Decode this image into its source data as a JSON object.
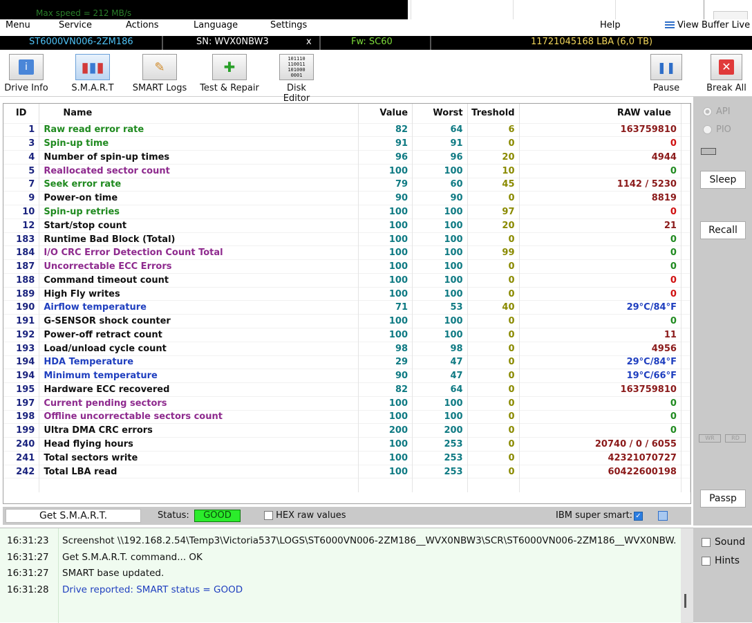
{
  "top_strip": {
    "speed_text": "Max speed = 212 MB/s"
  },
  "menu": {
    "items": [
      "Menu",
      "Service",
      "Actions",
      "Language",
      "Settings",
      "Help"
    ],
    "view_buffer": "View Buffer Live"
  },
  "drive": {
    "model": "ST6000VN006-2ZM186",
    "serial": "SN: WVX0NBW3",
    "close_glyph": "x",
    "firmware": "Fw: SC60",
    "capacity": "11721045168 LBA (6,0 TB)"
  },
  "toolbar": {
    "drive_info": "Drive Info",
    "smart": "S.M.A.R.T",
    "smart_logs": "SMART Logs",
    "test_repair": "Test & Repair",
    "disk_editor": "Disk Editor",
    "pause": "Pause",
    "break_all": "Break All"
  },
  "side": {
    "api": "API",
    "pio": "PIO",
    "sleep": "Sleep",
    "recall": "Recall",
    "wr": "WR",
    "rd": "RD",
    "passp": "Passp"
  },
  "table": {
    "headers": {
      "id": "ID",
      "name": "Name",
      "value": "Value",
      "worst": "Worst",
      "threshold": "Treshold",
      "raw": "RAW value"
    },
    "rows": [
      {
        "id": "1",
        "name": "Raw read error rate",
        "value": "82",
        "worst": "64",
        "threshold": "6",
        "raw": "163759810",
        "color": "#1f8a1f",
        "raw_color": "#8b1a1a"
      },
      {
        "id": "3",
        "name": "Spin-up time",
        "value": "91",
        "worst": "91",
        "threshold": "0",
        "raw": "0",
        "color": "#1f8a1f",
        "raw_color": "#d01010"
      },
      {
        "id": "4",
        "name": "Number of spin-up times",
        "value": "96",
        "worst": "96",
        "threshold": "20",
        "raw": "4944",
        "color": "#111111",
        "raw_color": "#8b1a1a"
      },
      {
        "id": "5",
        "name": "Reallocated sector count",
        "value": "100",
        "worst": "100",
        "threshold": "10",
        "raw": "0",
        "color": "#8e2a8e",
        "raw_color": "#1f8a1f"
      },
      {
        "id": "7",
        "name": "Seek error rate",
        "value": "79",
        "worst": "60",
        "threshold": "45",
        "raw": "1142 / 5230",
        "color": "#1f8a1f",
        "raw_color": "#8b1a1a"
      },
      {
        "id": "9",
        "name": "Power-on time",
        "value": "90",
        "worst": "90",
        "threshold": "0",
        "raw": "8819",
        "color": "#111111",
        "raw_color": "#8b1a1a"
      },
      {
        "id": "10",
        "name": "Spin-up retries",
        "value": "100",
        "worst": "100",
        "threshold": "97",
        "raw": "0",
        "color": "#1f8a1f",
        "raw_color": "#d01010"
      },
      {
        "id": "12",
        "name": "Start/stop count",
        "value": "100",
        "worst": "100",
        "threshold": "20",
        "raw": "21",
        "color": "#111111",
        "raw_color": "#8b1a1a"
      },
      {
        "id": "183",
        "name": "Runtime Bad Block (Total)",
        "value": "100",
        "worst": "100",
        "threshold": "0",
        "raw": "0",
        "color": "#111111",
        "raw_color": "#1f8a1f"
      },
      {
        "id": "184",
        "name": "I/O CRC Error Detection Count Total",
        "value": "100",
        "worst": "100",
        "threshold": "99",
        "raw": "0",
        "color": "#8e2a8e",
        "raw_color": "#1f8a1f"
      },
      {
        "id": "187",
        "name": "Uncorrectable ECC Errors",
        "value": "100",
        "worst": "100",
        "threshold": "0",
        "raw": "0",
        "color": "#8e2a8e",
        "raw_color": "#1f8a1f"
      },
      {
        "id": "188",
        "name": "Command timeout count",
        "value": "100",
        "worst": "100",
        "threshold": "0",
        "raw": "0",
        "color": "#111111",
        "raw_color": "#d01010"
      },
      {
        "id": "189",
        "name": "High Fly writes",
        "value": "100",
        "worst": "100",
        "threshold": "0",
        "raw": "0",
        "color": "#111111",
        "raw_color": "#d01010"
      },
      {
        "id": "190",
        "name": "Airflow temperature",
        "value": "71",
        "worst": "53",
        "threshold": "40",
        "raw": "29°C/84°F",
        "color": "#1f3fbf",
        "raw_color": "#1f3fbf"
      },
      {
        "id": "191",
        "name": "G-SENSOR shock counter",
        "value": "100",
        "worst": "100",
        "threshold": "0",
        "raw": "0",
        "color": "#111111",
        "raw_color": "#1f8a1f"
      },
      {
        "id": "192",
        "name": "Power-off retract count",
        "value": "100",
        "worst": "100",
        "threshold": "0",
        "raw": "11",
        "color": "#111111",
        "raw_color": "#8b1a1a"
      },
      {
        "id": "193",
        "name": "Load/unload cycle count",
        "value": "98",
        "worst": "98",
        "threshold": "0",
        "raw": "4956",
        "color": "#111111",
        "raw_color": "#8b1a1a"
      },
      {
        "id": "194",
        "name": "HDA Temperature",
        "value": "29",
        "worst": "47",
        "threshold": "0",
        "raw": "29°C/84°F",
        "color": "#1f3fbf",
        "raw_color": "#1f3fbf"
      },
      {
        "id": "194",
        "name": "Minimum temperature",
        "value": "90",
        "worst": "47",
        "threshold": "0",
        "raw": "19°C/66°F",
        "color": "#1f3fbf",
        "raw_color": "#1f3fbf"
      },
      {
        "id": "195",
        "name": "Hardware ECC recovered",
        "value": "82",
        "worst": "64",
        "threshold": "0",
        "raw": "163759810",
        "color": "#111111",
        "raw_color": "#8b1a1a"
      },
      {
        "id": "197",
        "name": "Current pending sectors",
        "value": "100",
        "worst": "100",
        "threshold": "0",
        "raw": "0",
        "color": "#8e2a8e",
        "raw_color": "#1f8a1f"
      },
      {
        "id": "198",
        "name": "Offline uncorrectable sectors count",
        "value": "100",
        "worst": "100",
        "threshold": "0",
        "raw": "0",
        "color": "#8e2a8e",
        "raw_color": "#1f8a1f"
      },
      {
        "id": "199",
        "name": "Ultra DMA CRC errors",
        "value": "200",
        "worst": "200",
        "threshold": "0",
        "raw": "0",
        "color": "#111111",
        "raw_color": "#1f8a1f"
      },
      {
        "id": "240",
        "name": "Head flying hours",
        "value": "100",
        "worst": "253",
        "threshold": "0",
        "raw": "20740 / 0 / 6055",
        "color": "#111111",
        "raw_color": "#8b1a1a"
      },
      {
        "id": "241",
        "name": "Total sectors write",
        "value": "100",
        "worst": "253",
        "threshold": "0",
        "raw": "42321070727",
        "color": "#111111",
        "raw_color": "#8b1a1a"
      },
      {
        "id": "242",
        "name": "Total LBA read",
        "value": "100",
        "worst": "253",
        "threshold": "0",
        "raw": "60422600198",
        "color": "#111111",
        "raw_color": "#8b1a1a"
      }
    ]
  },
  "statusbar": {
    "get_smart": "Get S.M.A.R.T.",
    "status_label": "Status:",
    "status_value": "GOOD",
    "hex_raw": "HEX raw values",
    "ibm_super_smart": "IBM super smart:"
  },
  "log": [
    {
      "time": "16:31:23",
      "text": "Screenshot \\\\192.168.2.54\\Temp3\\Victoria537\\LOGS\\ST6000VN006-2ZM186__WVX0NBW3\\SCR\\ST6000VN006-2ZM186__WVX0NBW.",
      "color": "#111111"
    },
    {
      "time": "16:31:27",
      "text": "Get S.M.A.R.T. command... OK",
      "color": "#111111"
    },
    {
      "time": "16:31:27",
      "text": "SMART base updated.",
      "color": "#111111"
    },
    {
      "time": "16:31:28",
      "text": "Drive reported: SMART status = GOOD",
      "color": "#1f3fbf"
    }
  ],
  "bottom_right": {
    "sound": "Sound",
    "hints": "Hints"
  }
}
